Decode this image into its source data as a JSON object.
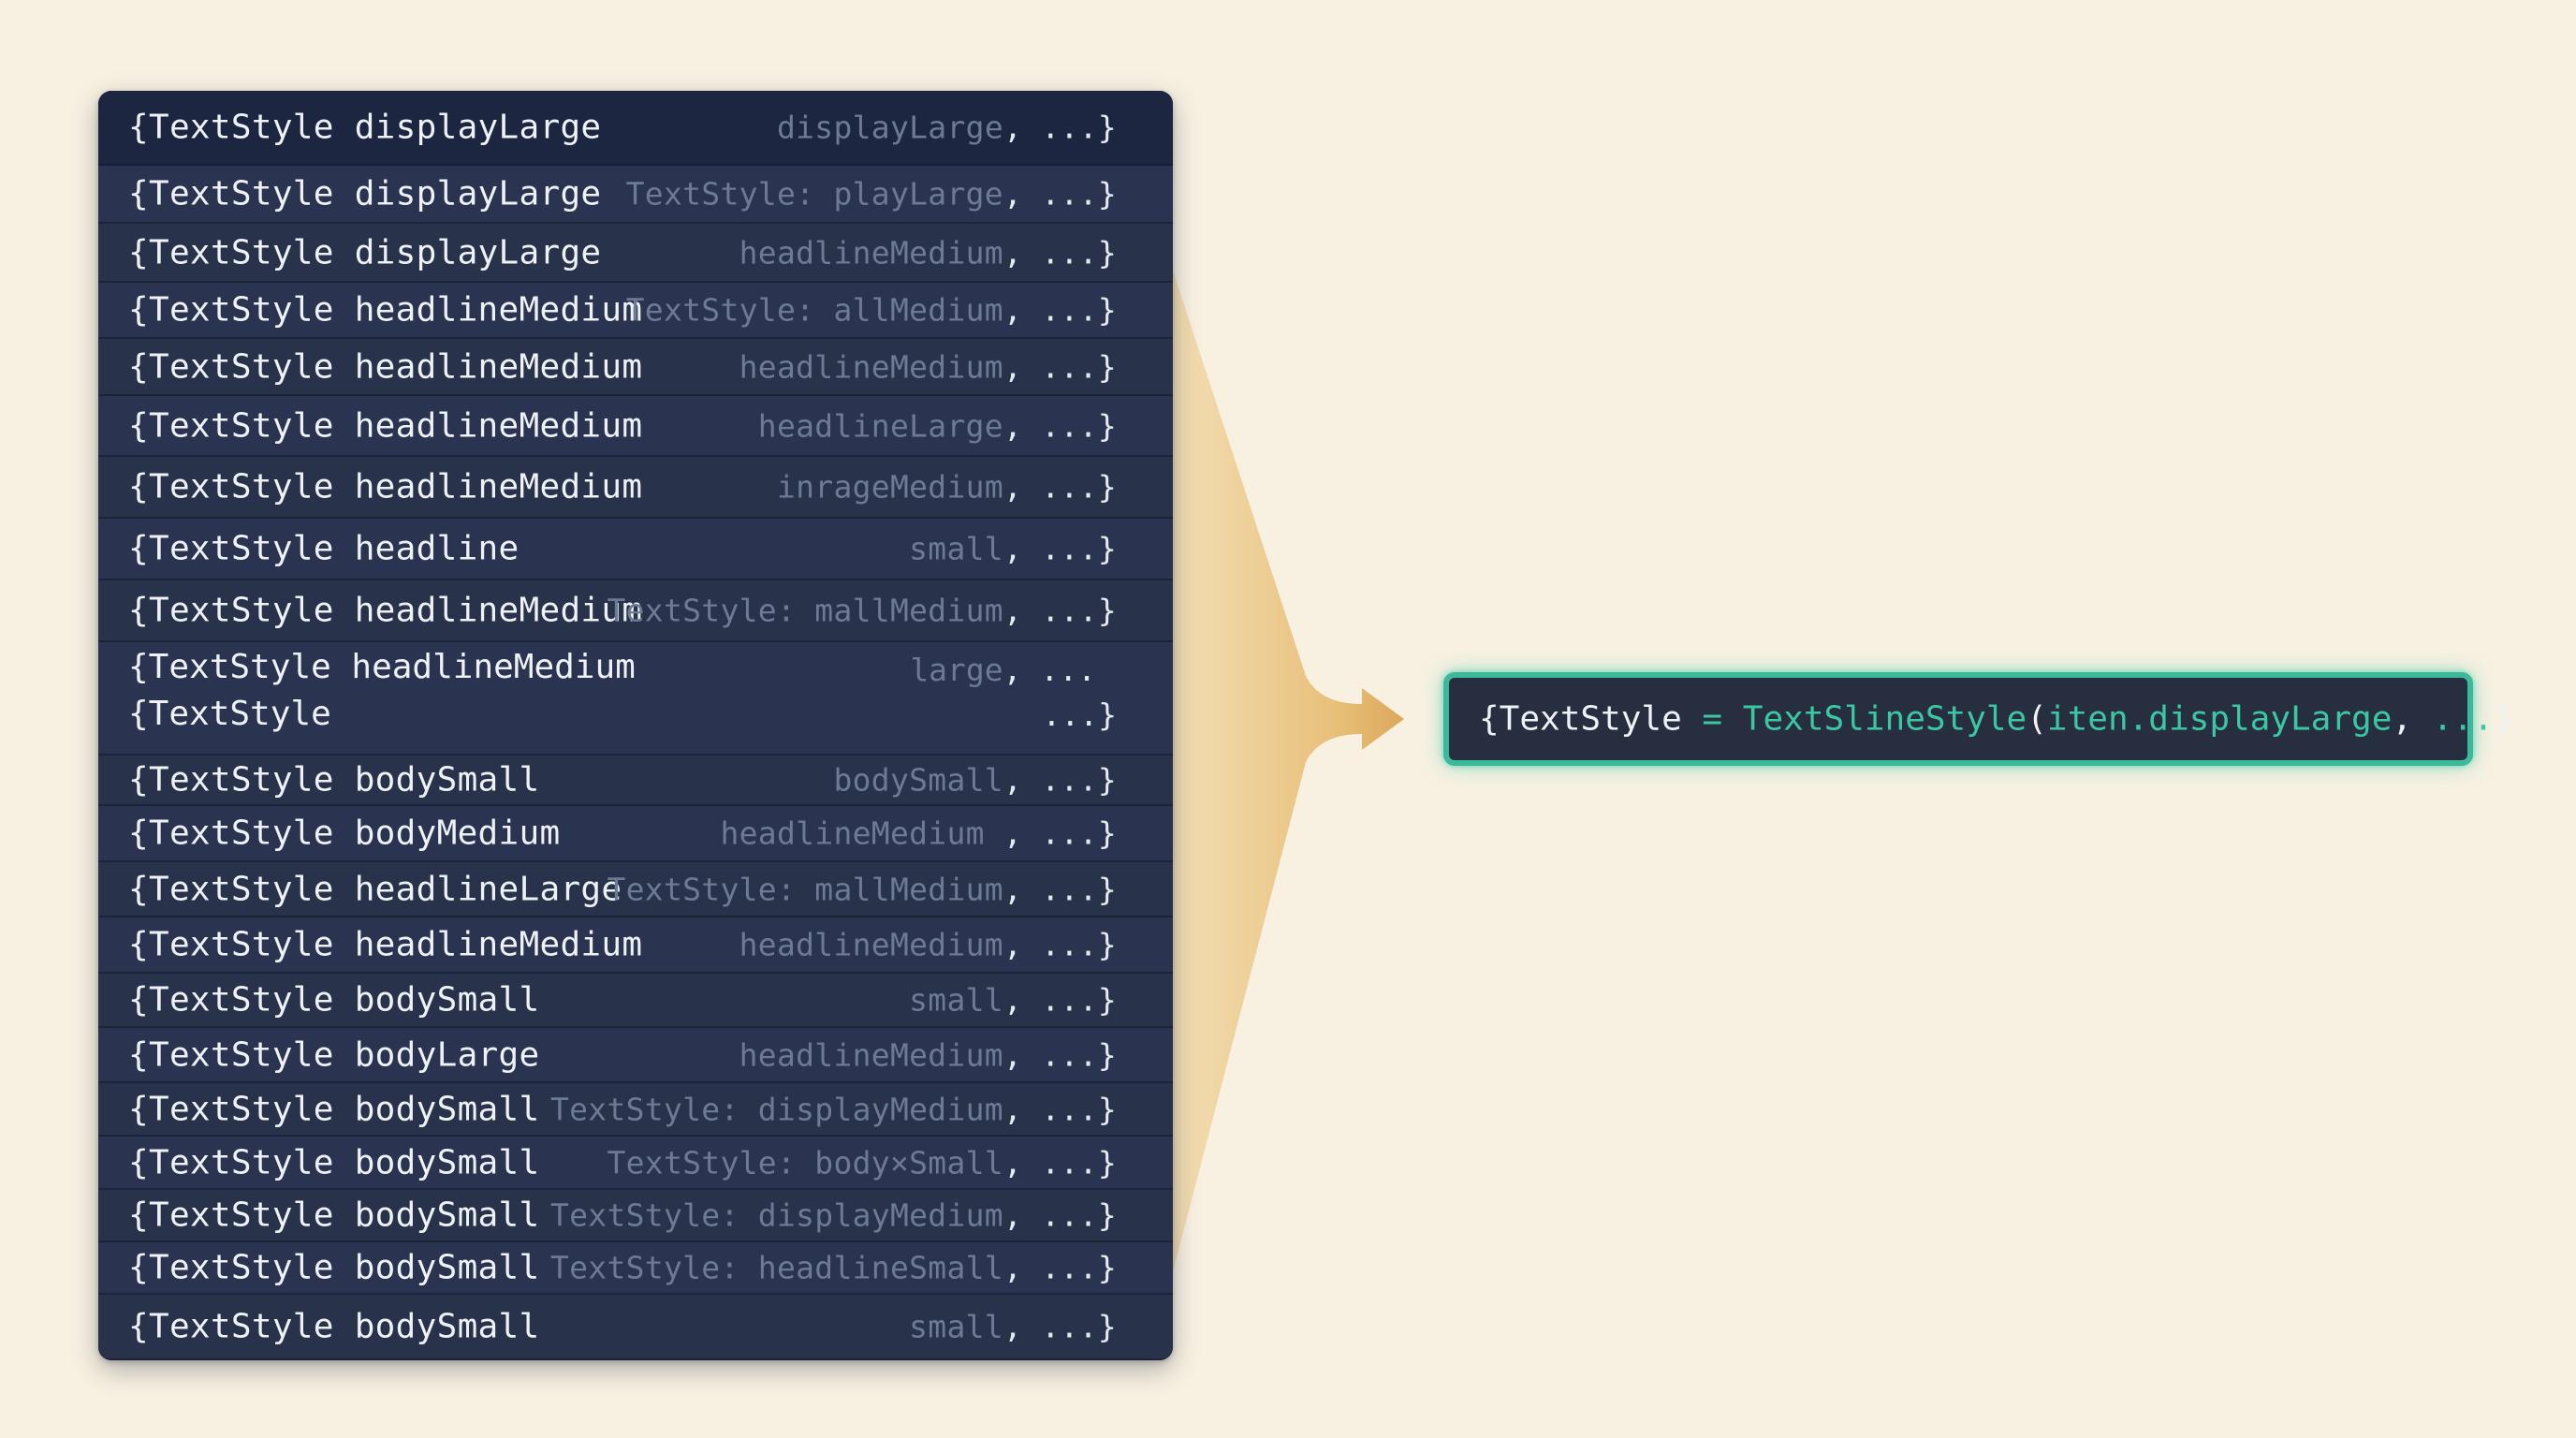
{
  "rows": [
    {
      "left": "{TextStyle displayLarge",
      "right_dim": "displayLarge",
      "right_end": ", ...}"
    },
    {
      "left": "{TextStyle displayLarge",
      "right_dim": "TextStyle: playLarge",
      "right_end": ", ...}"
    },
    {
      "left": "{TextStyle displayLarge",
      "right_dim": "headlineMedium",
      "right_end": ", ...}"
    },
    {
      "left": "{TextStyle headlineMedium",
      "right_dim": "TextStyle: allMedium",
      "right_end": ", ...}"
    },
    {
      "left": "{TextStyle headlineMedium",
      "right_dim": "headlineMedium",
      "right_end": ", ...}"
    },
    {
      "left": "{TextStyle headlineMedium",
      "right_dim": "headlineLarge",
      "right_end": ", ...}"
    },
    {
      "left": "{TextStyle headlineMedium",
      "right_dim": "inrageMedium",
      "right_end": ", ...}"
    },
    {
      "left": "{TextStyle headline",
      "right_dim": "small",
      "right_end": ", ...}"
    },
    {
      "left": "{TextStyle headlineMedium",
      "right_dim": "TextStyle: mallMedium",
      "right_end": ", ...}"
    },
    {
      "left": "{TextStyle headlineMedium",
      "left2": "{TextStyle",
      "right_dim": "large",
      "right_end": ", ...",
      "right_end2": "...}"
    },
    {
      "left": "{TextStyle bodySmall",
      "right_dim": "bodySmall",
      "right_end": ", ...}"
    },
    {
      "left": "{TextStyle bodyMedium",
      "right_dim": "headlineMedium ",
      "right_end": ", ...}"
    },
    {
      "left": "{TextStyle headlineLarge",
      "right_dim": "TextStyle: mallMedium",
      "right_end": ", ...}"
    },
    {
      "left": "{TextStyle headlineMedium",
      "right_dim": "headlineMedium",
      "right_end": ", ...}"
    },
    {
      "left": "{TextStyle bodySmall",
      "right_dim": "small",
      "right_end": ", ...}"
    },
    {
      "left": "{TextStyle bodyLarge",
      "right_dim": "headlineMedium",
      "right_end": ", ...}"
    },
    {
      "left": "{TextStyle bodySmall",
      "right_dim": "TextStyle: displayMedium",
      "right_end": ", ...}"
    },
    {
      "left": "{TextStyle bodySmall",
      "right_dim": "TextStyle: body×Small",
      "right_end": ", ...}"
    },
    {
      "left": "{TextStyle bodySmall",
      "right_dim": "TextStyle: displayMedium",
      "right_end": ", ...}"
    },
    {
      "left": "{TextStyle bodySmall",
      "right_dim": "TextStyle: headlineSmall",
      "right_end": ", ...}"
    },
    {
      "left": "{TextStyle bodySmall",
      "right_dim": "small",
      "right_end": ", ...}"
    }
  ],
  "result": {
    "part1": "{TextStyle ",
    "equals": "=",
    "part2": " ",
    "fn": "TextSlineStyle",
    "paren": "(",
    "arg": "iten.displayLarge",
    "comma": ", ",
    "ellipsis": "...",
    "close": "}"
  },
  "colors": {
    "background": "#f8f1e2",
    "panel": "#273149",
    "funnel": "#e2b567",
    "accent_teal": "#3cb89b"
  }
}
